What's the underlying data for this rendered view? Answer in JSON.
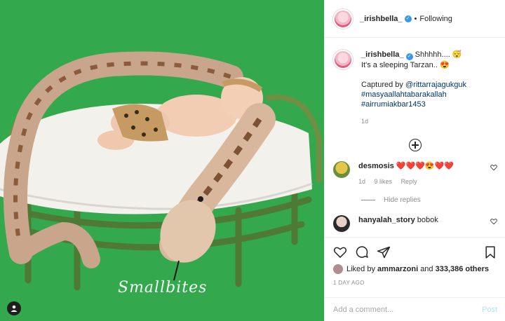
{
  "header": {
    "username": "_irishbella_",
    "separator": "•",
    "follow_label": "Following"
  },
  "photo": {
    "watermark": "Smallbites",
    "background_color": "#2fa64a"
  },
  "caption": {
    "username": "_irishbella_",
    "line1": "Shhhhh.... 😴",
    "line2": "It's a sleeping Tarzan.. 😍",
    "captured_by": "Captured by",
    "mention": "@rittarrajagukguk",
    "hashtag1": "#masyaallahtabarakallah",
    "hashtag2": "#airrumiakbar1453",
    "age": "1d"
  },
  "comments": [
    {
      "username": "desmosis",
      "text": "❤️❤️❤️😍❤️❤️",
      "age": "1d",
      "likes": "9 likes",
      "reply_label": "Reply"
    },
    {
      "username": "hanyalah_story",
      "text": "bobok"
    }
  ],
  "hide_replies_label": "Hide replies",
  "likes": {
    "prefix": "Liked by",
    "user": "ammarzoni",
    "and": "and",
    "others": "333,386 others"
  },
  "timestamp": "1 DAY AGO",
  "add_comment": {
    "placeholder": "Add a comment...",
    "post_label": "Post"
  }
}
